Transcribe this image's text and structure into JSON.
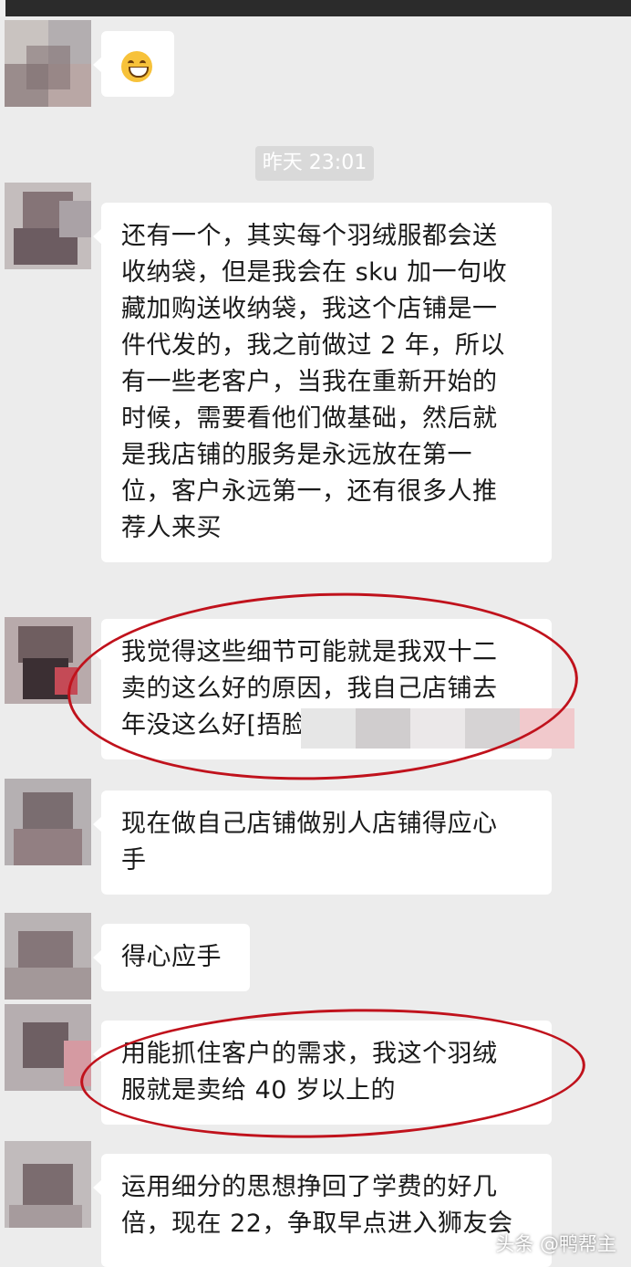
{
  "timestamp": "昨天 23:01",
  "messages": [
    {
      "type": "emoji",
      "emoji": "grinning-face"
    },
    {
      "type": "text",
      "lines": [
        "还有一个，其实每个羽绒服都会送",
        "收纳袋，但是我会在 sku 加一句收",
        "藏加购送收纳袋，我这个店铺是一",
        "件代发的，我之前做过 2 年，所以",
        "有一些老客户，当我在重新开始的",
        "时候，需要看他们做基础，然后就",
        "是我店铺的服务是永远放在第一",
        "位，客户永远第一，还有很多人推",
        "荐人来买"
      ]
    },
    {
      "type": "text",
      "lines": [
        "我觉得这些细节可能就是我双十二",
        "卖的这么好的原因，我自己店铺去",
        "年没这么好[捂脸"
      ]
    },
    {
      "type": "text",
      "lines": [
        "现在做自己店铺做别人店铺得应心",
        "手"
      ]
    },
    {
      "type": "text",
      "lines": [
        "得心应手"
      ]
    },
    {
      "type": "text",
      "lines": [
        "用能抓住客户的需求，我这个羽绒",
        "服就是卖给 40 岁以上的"
      ]
    },
    {
      "type": "text",
      "lines": [
        "运用细分的思想挣回了学费的好几",
        "倍，现在 22，争取早点进入狮友会"
      ]
    }
  ],
  "watermark": "头条 @鸭帮主",
  "colors": {
    "background": "#ececec",
    "bubble": "#ffffff",
    "highlight_circle": "#c0121c",
    "time_badge": "#d9d9d9"
  }
}
